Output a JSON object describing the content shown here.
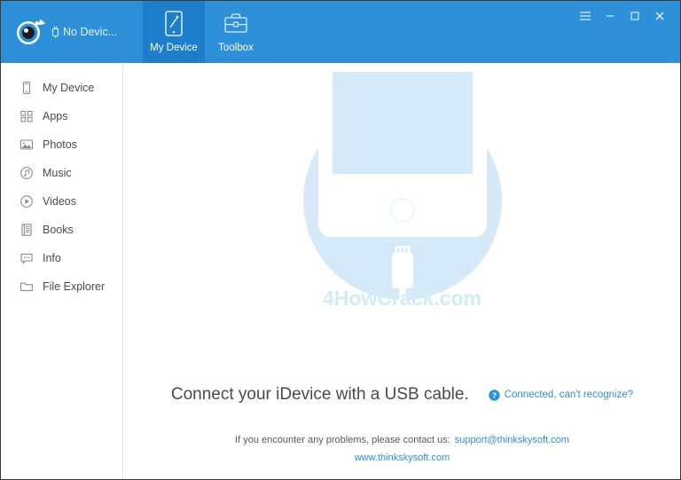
{
  "window": {
    "device_status": "No Devic...",
    "controls": [
      {
        "name": "menu-button",
        "glyph": "☰"
      },
      {
        "name": "minimize-button",
        "glyph": "–"
      },
      {
        "name": "maximize-button",
        "glyph": "□"
      },
      {
        "name": "close-button",
        "glyph": "✕"
      }
    ]
  },
  "colors": {
    "header_blue": "#2e90d9",
    "active_tab_blue": "#1d7fcb",
    "link_blue": "#2e90d9",
    "illustration_circle": "#d6e9f9",
    "watermark": "#d2ecf7"
  },
  "tabs": [
    {
      "label": "My Device",
      "icon": "tablet-icon",
      "active": true
    },
    {
      "label": "Toolbox",
      "icon": "briefcase-icon",
      "active": false
    }
  ],
  "sidebar": {
    "items": [
      {
        "label": "My Device",
        "icon": "device-icon"
      },
      {
        "label": "Apps",
        "icon": "apps-grid-icon"
      },
      {
        "label": "Photos",
        "icon": "photos-icon"
      },
      {
        "label": "Music",
        "icon": "music-icon"
      },
      {
        "label": "Videos",
        "icon": "videos-icon"
      },
      {
        "label": "Books",
        "icon": "books-icon"
      },
      {
        "label": "Info",
        "icon": "info-bubble-icon"
      },
      {
        "label": "File Explorer",
        "icon": "folder-icon"
      }
    ]
  },
  "main": {
    "watermark": "4HowCrack.com",
    "connect_title": "Connect your iDevice with a USB cable.",
    "recognize_link": "Connected, can't recognize?",
    "recognize_icon": "question-circle-icon",
    "footer_text": "If you encounter any problems, please contact us:",
    "support_email": "support@thinkskysoft.com",
    "website": "www.thinkskysoft.com"
  }
}
